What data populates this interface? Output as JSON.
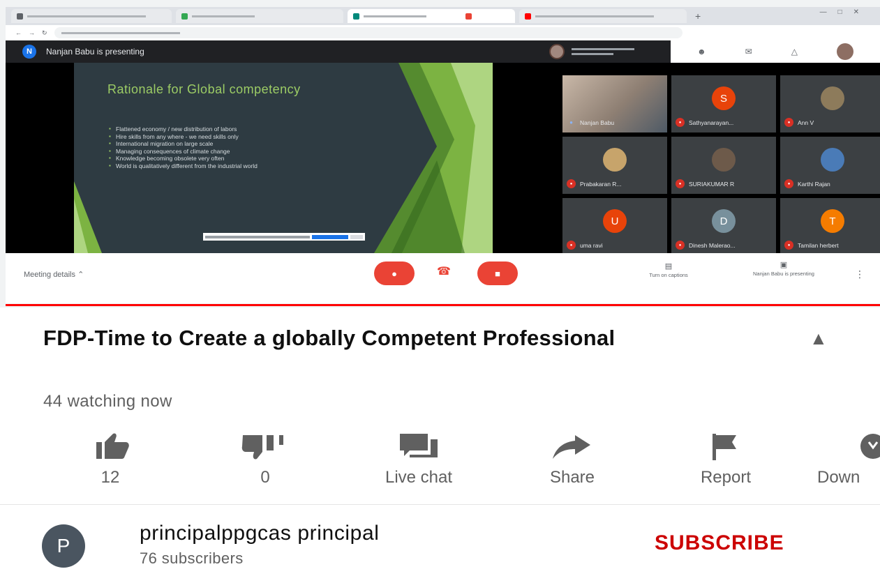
{
  "meet": {
    "presenting_label": "Nanjan Babu is presenting",
    "presenter_initial": "N",
    "meeting_details_label": "Meeting details",
    "captions_label": "Turn on captions",
    "presenter_status": "Nanjan Babu is presenting"
  },
  "slide": {
    "title": "Rationale for Global competency",
    "bullets": [
      "Flattened economy / new distribution of labors",
      "Hire skills from any where - we need skills only",
      "International migration on large scale",
      "Managing consequences of climate change",
      "Knowledge becoming obsolete very often",
      "World is qualitatively different from the industrial world"
    ]
  },
  "participants": [
    {
      "name": "Nanjan Babu",
      "initial": "",
      "color": "",
      "muted": false,
      "camera": true
    },
    {
      "name": "Sathyanarayan...",
      "initial": "S",
      "color": "#e8430a",
      "muted": true,
      "camera": false
    },
    {
      "name": "Ann V",
      "initial": "",
      "color": "#8d7b5b",
      "muted": true,
      "camera": false
    },
    {
      "name": "Prabakaran R...",
      "initial": "",
      "color": "#c7a46b",
      "muted": true,
      "camera": false
    },
    {
      "name": "SURIAKUMAR R",
      "initial": "",
      "color": "#6d5a4a",
      "muted": true,
      "camera": false
    },
    {
      "name": "Karthi Rajan",
      "initial": "",
      "color": "#4a7bb7",
      "muted": true,
      "camera": false
    },
    {
      "name": "uma ravi",
      "initial": "U",
      "color": "#e8430a",
      "muted": true,
      "camera": false
    },
    {
      "name": "Dinesh Malerao...",
      "initial": "D",
      "color": "#78909c",
      "muted": true,
      "camera": false
    },
    {
      "name": "Tamilan herbert",
      "initial": "T",
      "color": "#f57c00",
      "muted": true,
      "camera": false
    }
  ],
  "video": {
    "progress_fraction": 1.0
  },
  "youtube": {
    "title": "FDP-Time to Create a globally Competent Professional",
    "watching": "44 watching now",
    "actions": {
      "like_count": "12",
      "dislike_count": "0",
      "live_chat_label": "Live chat",
      "share_label": "Share",
      "report_label": "Report",
      "download_label": "Down"
    },
    "channel": {
      "initial": "P",
      "name": "principalppgcas principal",
      "subscribers": "76 subscribers",
      "subscribe_label": "SUBSCRIBE"
    }
  },
  "colors": {
    "youtube_red": "#ff0000",
    "subscribe_red": "#cc0000",
    "meet_red": "#ea4335",
    "slide_green": "#9ccc65"
  }
}
